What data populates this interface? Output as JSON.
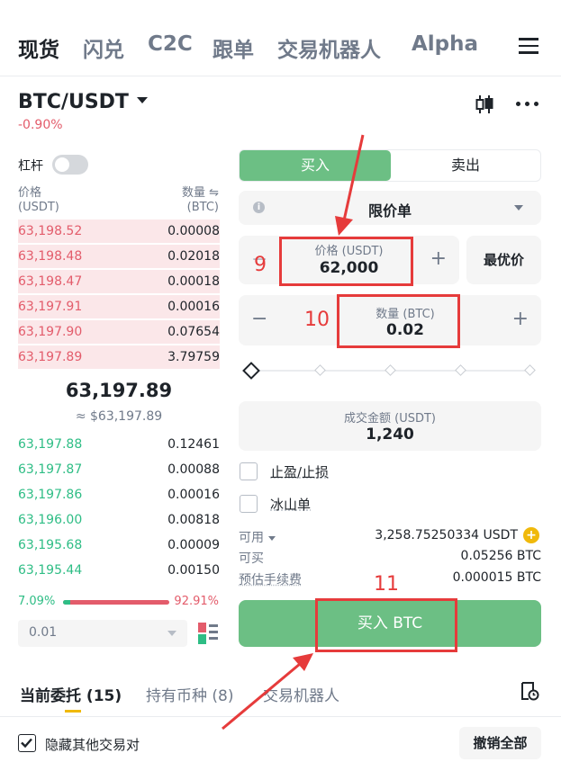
{
  "top_tabs": [
    "现货",
    "闪兑",
    "C2C",
    "跟单",
    "交易机器人",
    "Alpha"
  ],
  "pair": {
    "name": "BTC/USDT",
    "change": "-0.90%"
  },
  "leverage_label": "杠杆",
  "orderbook": {
    "price_header": "价格",
    "price_unit": "(USDT)",
    "qty_header": "数量 ⇋",
    "qty_unit": "(BTC)",
    "asks": [
      {
        "price": "63,198.52",
        "qty": "0.00008"
      },
      {
        "price": "63,198.48",
        "qty": "0.02018"
      },
      {
        "price": "63,198.47",
        "qty": "0.00018"
      },
      {
        "price": "63,197.91",
        "qty": "0.00016"
      },
      {
        "price": "63,197.90",
        "qty": "0.07654"
      },
      {
        "price": "63,197.89",
        "qty": "3.79759"
      }
    ],
    "last_price": "63,197.89",
    "last_price_fiat": "≈ $63,197.89",
    "bids": [
      {
        "price": "63,197.88",
        "qty": "0.12461"
      },
      {
        "price": "63,197.87",
        "qty": "0.00088"
      },
      {
        "price": "63,197.86",
        "qty": "0.00016"
      },
      {
        "price": "63,196.00",
        "qty": "0.00818"
      },
      {
        "price": "63,195.68",
        "qty": "0.00009"
      },
      {
        "price": "63,195.44",
        "qty": "0.00150"
      }
    ],
    "buy_ratio": "7.09%",
    "sell_ratio": "92.91%",
    "buy_ratio_value": 7.09,
    "precision": "0.01"
  },
  "form": {
    "buy_tab": "买入",
    "sell_tab": "卖出",
    "order_type": "限价单",
    "price_label": "价格 (USDT)",
    "price_value": "62,000",
    "best_price": "最优价",
    "qty_label": "数量 (BTC)",
    "qty_value": "0.02",
    "total_label": "成交金额 (USDT)",
    "total_value": "1,240",
    "tp_sl": "止盈/止损",
    "iceberg": "冰山单",
    "available_label": "可用",
    "available_value": "3,258.75250334 USDT",
    "can_buy_label": "可买",
    "can_buy_value": "0.05256 BTC",
    "fee_label": "预估手续费",
    "fee_value": "0.000015 BTC",
    "submit": "买入 BTC"
  },
  "annotations": {
    "n9": "9",
    "n10": "10",
    "n11": "11"
  },
  "bottom_tabs": [
    {
      "label": "当前委托 (15)"
    },
    {
      "label": "持有币种 (8)"
    },
    {
      "label": "交易机器人"
    }
  ],
  "hide_others": "隐藏其他交易对",
  "cancel_all": "撤销全部",
  "colors": {
    "green": "#2ebd85",
    "buy_btn": "#6cbf84",
    "red": "#e35c6b",
    "annotation": "#e63b3b"
  }
}
